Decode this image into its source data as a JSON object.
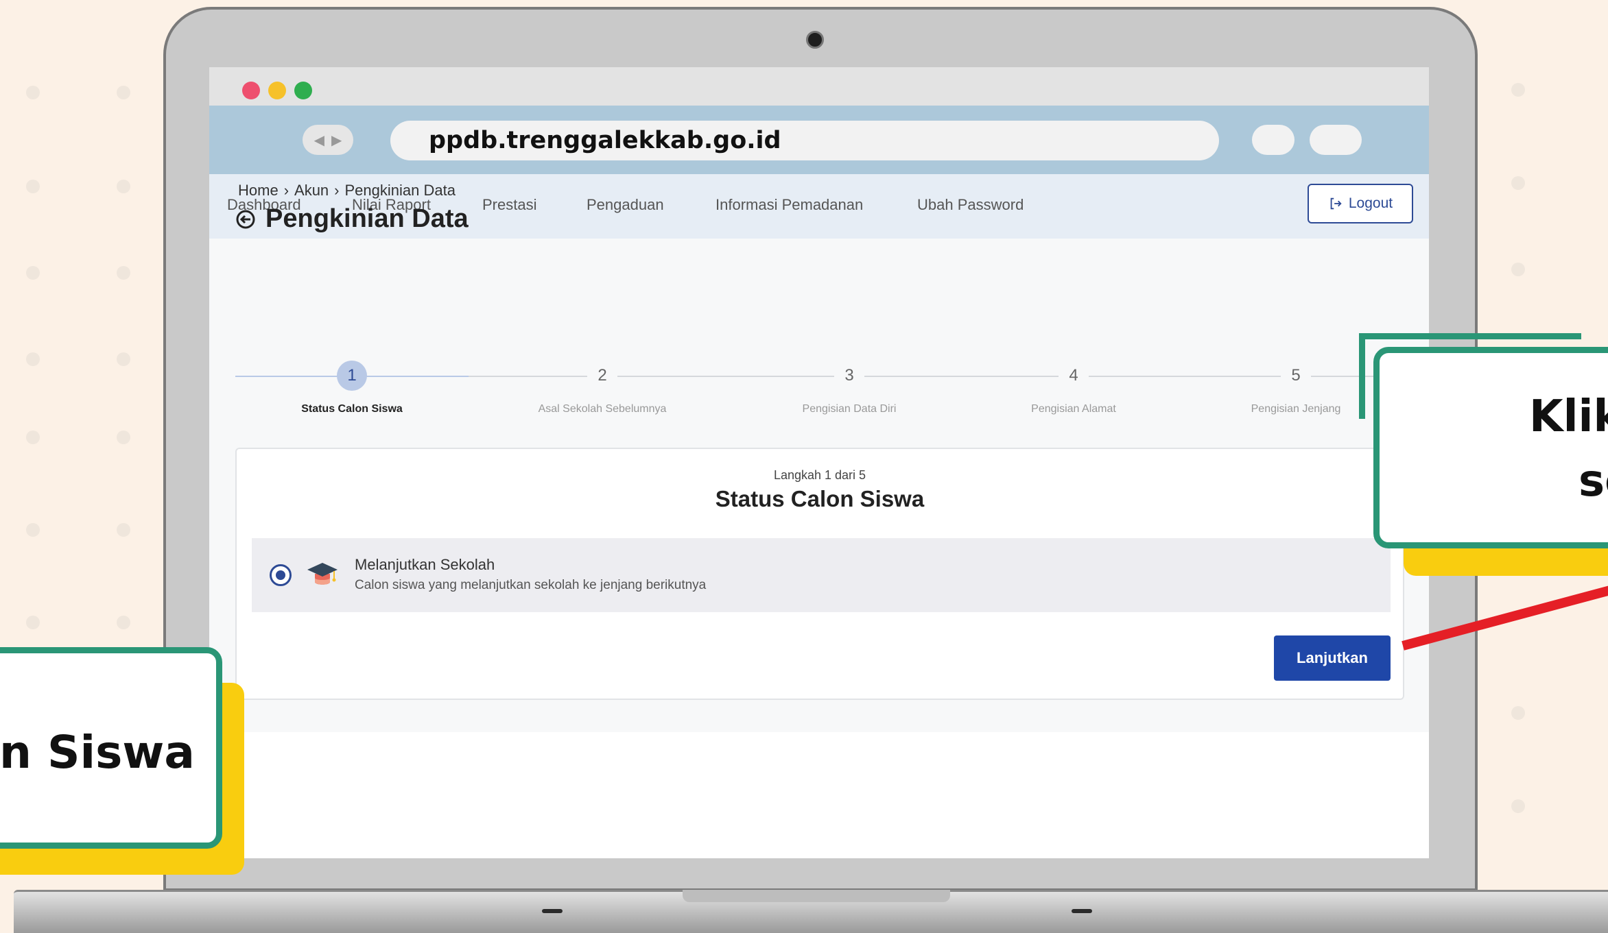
{
  "browser": {
    "url": "ppdb.trenggalekkab.go.id",
    "traffic_colors": [
      "#ee4f6e",
      "#f6c12a",
      "#2fae4f"
    ]
  },
  "nav": {
    "items": [
      "Dashboard",
      "Nilai Raport",
      "Prestasi",
      "Pengaduan",
      "Informasi Pemadanan",
      "Ubah Password"
    ],
    "logout_label": "Logout"
  },
  "breadcrumb": {
    "items": [
      "Home",
      "Akun",
      "Pengkinian Data"
    ]
  },
  "page": {
    "title": "Pengkinian Data"
  },
  "stepper": {
    "steps": [
      {
        "number": "1",
        "label": "Status Calon Siswa",
        "active": true
      },
      {
        "number": "2",
        "label": "Asal Sekolah Sebelumnya",
        "active": false
      },
      {
        "number": "3",
        "label": "Pengisian Data Diri",
        "active": false
      },
      {
        "number": "4",
        "label": "Pengisian Alamat",
        "active": false
      },
      {
        "number": "5",
        "label": "Pengisian Jenjang",
        "active": false
      }
    ]
  },
  "card": {
    "step_text": "Langkah 1 dari 5",
    "title": "Status Calon Siswa",
    "option": {
      "title": "Melanjutkan Sekolah",
      "description": "Calon siswa yang melanjutkan sekolah ke jenjang berikutnya",
      "selected": true
    },
    "next_label": "Lanjutkan"
  },
  "callouts": {
    "right_line1": "Klik",
    "right_line2": "se",
    "left_text": "n Siswa"
  },
  "colors": {
    "accent": "#1f47a8",
    "callout_border": "#2a9676",
    "callout_shadow": "#f9cd0f",
    "pointer": "#e51f26"
  }
}
